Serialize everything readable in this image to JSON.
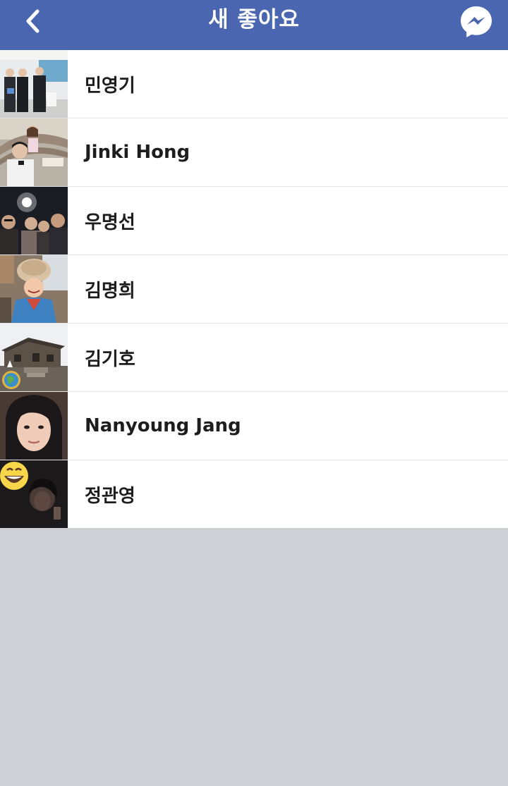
{
  "header": {
    "title": "새 좋아요",
    "back_icon": "chevron-left-icon",
    "messenger_icon": "messenger-icon"
  },
  "colors": {
    "navbar": "#4a66b0",
    "background": "#cdd0d4",
    "list_background": "#ffffff"
  },
  "likers": [
    {
      "name": "민영기"
    },
    {
      "name": "Jinki Hong"
    },
    {
      "name": "우명선"
    },
    {
      "name": "김명희"
    },
    {
      "name": "김기호"
    },
    {
      "name": "Nanyoung Jang"
    },
    {
      "name": "정관영"
    }
  ]
}
